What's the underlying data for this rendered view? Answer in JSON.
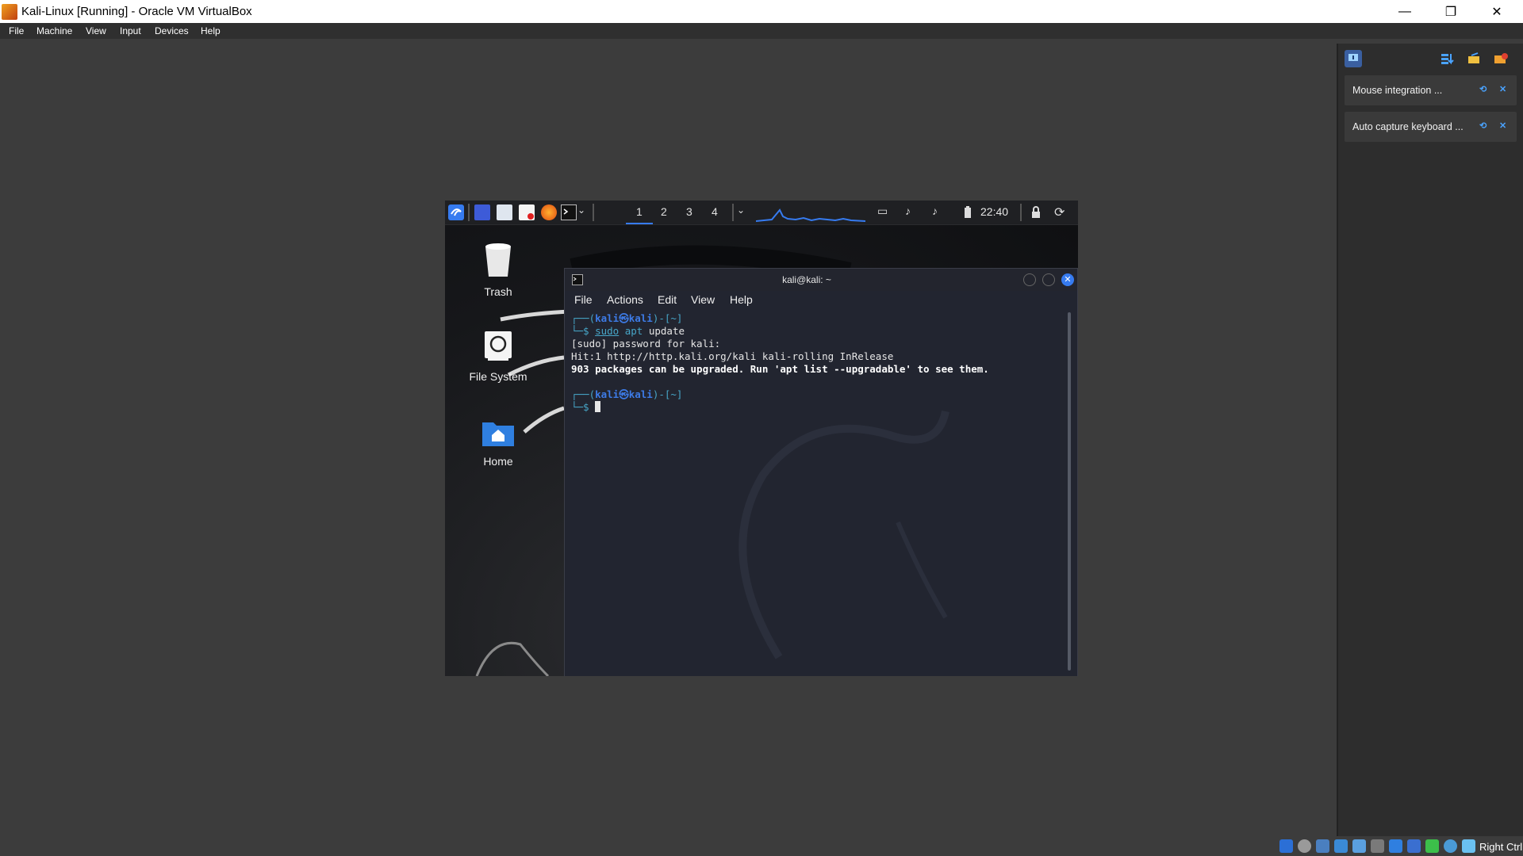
{
  "window": {
    "title": "Kali-Linux [Running] - Oracle VM VirtualBox",
    "minimize_glyph": "—",
    "maximize_glyph": "❐",
    "close_glyph": "✕"
  },
  "menubar": {
    "items": [
      "File",
      "Machine",
      "View",
      "Input",
      "Devices",
      "Help"
    ]
  },
  "notifications": {
    "items": [
      {
        "text": "Mouse integration ...",
        "pin": "⟲",
        "close": "✕"
      },
      {
        "text": "Auto capture keyboard ...",
        "pin": "⟲",
        "close": "✕"
      }
    ]
  },
  "statusbar": {
    "host_key": "Right Ctrl"
  },
  "vm": {
    "panel": {
      "workspaces": [
        "1",
        "2",
        "3",
        "4"
      ],
      "clock": "22:40"
    },
    "desktop_icons": [
      {
        "label": "Trash"
      },
      {
        "label": "File System"
      },
      {
        "label": "Home"
      }
    ],
    "terminal": {
      "title": "kali@kali: ~",
      "menu": [
        "File",
        "Actions",
        "Edit",
        "View",
        "Help"
      ],
      "lines": {
        "prompt1_a": "┌──(",
        "prompt1_user": "kali㉿kali",
        "prompt1_b": ")-[~]",
        "prompt1_c": "└─$ ",
        "cmd_sudo": "sudo",
        "cmd_apt": "apt",
        "cmd_rest": " update",
        "out1": "[sudo] password for kali:",
        "out2": "Hit:1 http://http.kali.org/kali kali-rolling InRelease",
        "out3": "903 packages can be upgraded. Run 'apt list --upgradable' to see them.",
        "prompt2_a": "┌──(",
        "prompt2_user": "kali㉿kali",
        "prompt2_b": ")-[~]",
        "prompt2_c": "└─$ "
      }
    }
  },
  "colors": {
    "accent": "#367bf0",
    "prompt": "#47a6c8",
    "prompt_user": "#3d7be6"
  }
}
